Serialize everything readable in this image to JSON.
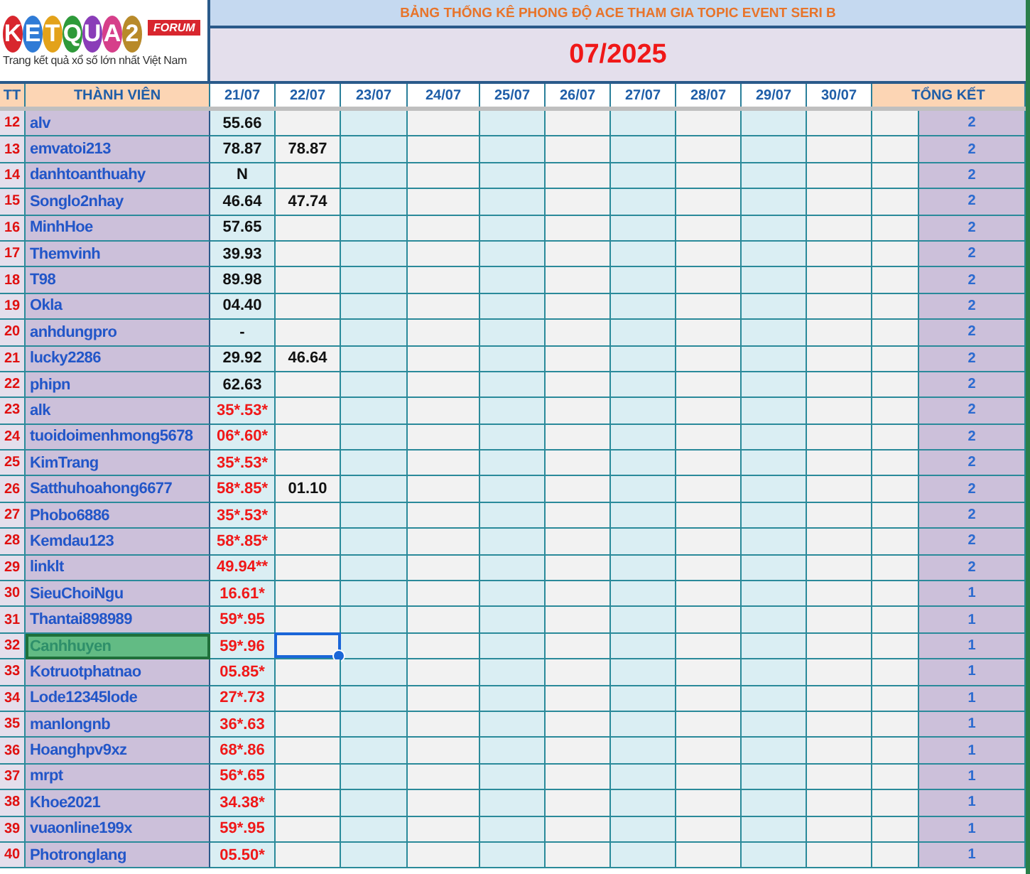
{
  "logo": {
    "wordmark": "KETQUA2",
    "badge": "FORUM",
    "tagline": "Trang kết quả xổ số lớn nhất Việt Nam"
  },
  "title": "BẢNG THỐNG KÊ PHONG ĐỘ ACE THAM GIA TOPIC EVENT SERI B",
  "period": "07/2025",
  "columns": {
    "number": "TT",
    "member": "THÀNH VIÊN",
    "dates": [
      "21/07",
      "22/07",
      "23/07",
      "24/07",
      "25/07",
      "26/07",
      "27/07",
      "28/07",
      "29/07",
      "30/07"
    ],
    "total": "TỔNG KẾT"
  },
  "rows": [
    {
      "tt": "12",
      "name": "alv",
      "d1": "55.66",
      "total": "2",
      "marked": false,
      "selected": false
    },
    {
      "tt": "13",
      "name": "emvatoi213",
      "d1": "78.87",
      "d2": "78.87",
      "total": "2",
      "marked": false,
      "selected": false
    },
    {
      "tt": "14",
      "name": "danhtoanthuahy",
      "d1": "N",
      "total": "2",
      "marked": false,
      "selected": false
    },
    {
      "tt": "15",
      "name": "Songlo2nhay",
      "d1": "46.64",
      "d2": "47.74",
      "total": "2",
      "marked": false,
      "selected": false
    },
    {
      "tt": "16",
      "name": "MinhHoe",
      "d1": "57.65",
      "total": "2",
      "marked": false,
      "selected": false
    },
    {
      "tt": "17",
      "name": "Themvinh",
      "d1": "39.93",
      "total": "2",
      "marked": false,
      "selected": false
    },
    {
      "tt": "18",
      "name": "T98",
      "d1": "89.98",
      "total": "2",
      "marked": false,
      "selected": false
    },
    {
      "tt": "19",
      "name": "Okla",
      "d1": "04.40",
      "total": "2",
      "marked": false,
      "selected": false
    },
    {
      "tt": "20",
      "name": "anhdungpro",
      "d1": "-",
      "total": "2",
      "marked": false,
      "selected": false
    },
    {
      "tt": "21",
      "name": "lucky2286",
      "d1": "29.92",
      "d2": "46.64",
      "total": "2",
      "marked": false,
      "selected": false
    },
    {
      "tt": "22",
      "name": "phipn",
      "d1": "62.63",
      "total": "2",
      "marked": false,
      "selected": false
    },
    {
      "tt": "23",
      "name": "alk",
      "d1": "35*.53*",
      "total": "2",
      "marked": true,
      "selected": false
    },
    {
      "tt": "24",
      "name": "tuoidoimenhmong5678",
      "d1": "06*.60*",
      "total": "2",
      "marked": true,
      "selected": false
    },
    {
      "tt": "25",
      "name": "KimTrang",
      "d1": "35*.53*",
      "total": "2",
      "marked": true,
      "selected": false
    },
    {
      "tt": "26",
      "name": "Satthuhoahong6677",
      "d1": "58*.85*",
      "d2": "01.10",
      "total": "2",
      "marked": true,
      "selected": false
    },
    {
      "tt": "27",
      "name": "Phobo6886",
      "d1": "35*.53*",
      "total": "2",
      "marked": true,
      "selected": false
    },
    {
      "tt": "28",
      "name": "Kemdau123",
      "d1": "58*.85*",
      "total": "2",
      "marked": true,
      "selected": false
    },
    {
      "tt": "29",
      "name": "linklt",
      "d1": "49.94**",
      "total": "2",
      "marked": true,
      "selected": false
    },
    {
      "tt": "30",
      "name": "SieuChoiNgu",
      "d1": "16.61*",
      "total": "1",
      "marked": true,
      "selected": false
    },
    {
      "tt": "31",
      "name": "Thantai898989",
      "d1": "59*.95",
      "total": "1",
      "marked": true,
      "selected": false
    },
    {
      "tt": "32",
      "name": "Canhhuyen",
      "d1": "59*.96",
      "total": "1",
      "marked": true,
      "selected": true
    },
    {
      "tt": "33",
      "name": "Kotruotphatnao",
      "d1": "05.85*",
      "total": "1",
      "marked": true,
      "selected": false
    },
    {
      "tt": "34",
      "name": "Lode12345lode",
      "d1": "27*.73",
      "total": "1",
      "marked": true,
      "selected": false
    },
    {
      "tt": "35",
      "name": "manlongnb",
      "d1": "36*.63",
      "total": "1",
      "marked": true,
      "selected": false
    },
    {
      "tt": "36",
      "name": "Hoanghpv9xz",
      "d1": "68*.86",
      "total": "1",
      "marked": true,
      "selected": false
    },
    {
      "tt": "37",
      "name": "mrpt",
      "d1": "56*.65",
      "total": "1",
      "marked": true,
      "selected": false
    },
    {
      "tt": "38",
      "name": "Khoe2021",
      "d1": "34.38*",
      "total": "1",
      "marked": true,
      "selected": false
    },
    {
      "tt": "39",
      "name": "vuaonline199x",
      "d1": "59*.95",
      "total": "1",
      "marked": true,
      "selected": false
    },
    {
      "tt": "40",
      "name": "Photronglang",
      "d1": "05.50*",
      "total": "1",
      "marked": true,
      "selected": false
    }
  ]
}
